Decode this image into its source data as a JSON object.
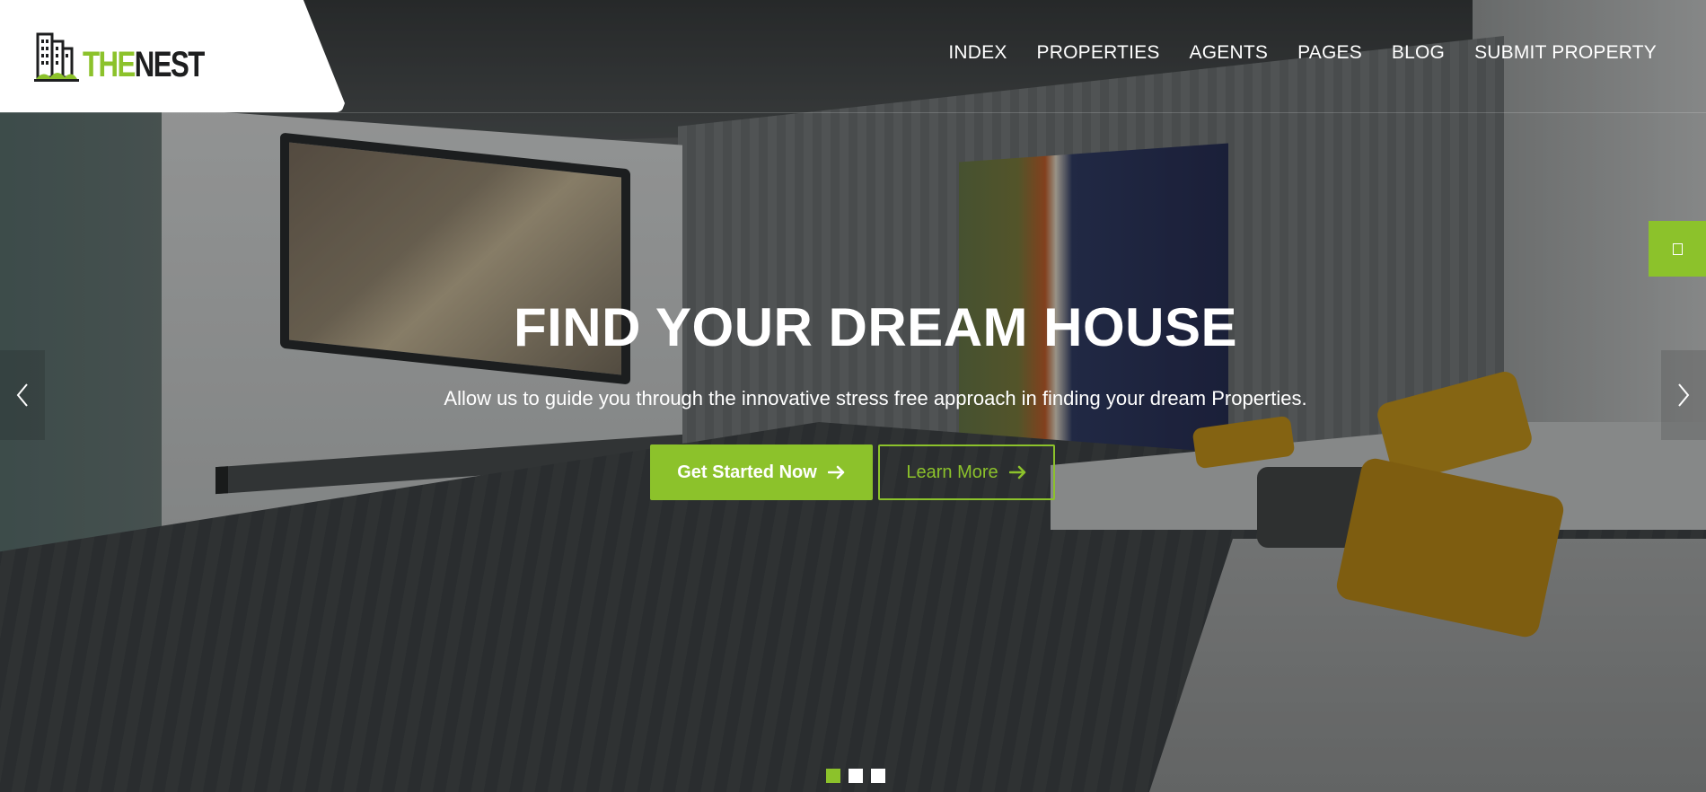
{
  "brand": {
    "logo_prefix": "THE",
    "logo_suffix": "NEST",
    "accent_color": "#8cc22b",
    "dark_color": "#1d1e1f"
  },
  "nav": {
    "items": [
      {
        "label": "INDEX"
      },
      {
        "label": "PROPERTIES"
      },
      {
        "label": "AGENTS"
      },
      {
        "label": "PAGES"
      },
      {
        "label": "BLOG"
      },
      {
        "label": "SUBMIT PROPERTY"
      }
    ]
  },
  "hero": {
    "title": "FIND YOUR DREAM HOUSE",
    "subtitle": "Allow us to guide you through the innovative stress free approach in finding your dream Properties.",
    "primary_button": {
      "label": "Get Started Now",
      "icon": "arrow-right-icon"
    },
    "secondary_button": {
      "label": "Learn More",
      "icon": "arrow-right-icon"
    }
  },
  "slider": {
    "prev_icon": "chevron-left-icon",
    "next_icon": "chevron-right-icon",
    "slide_count": 3,
    "active_slide": 1
  },
  "side_tab": {
    "icon": "settings-tab-icon"
  }
}
